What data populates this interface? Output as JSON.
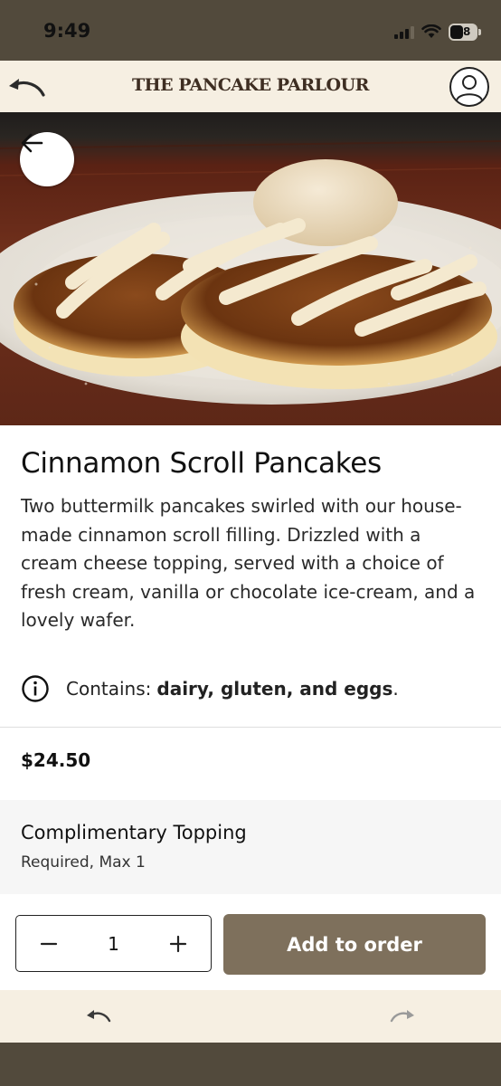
{
  "status_bar": {
    "time": "9:49",
    "battery": "48"
  },
  "header": {
    "brand": "THE PANCAKE PARLOUR",
    "back_icon": "curved-back-arrow-icon",
    "account_icon": "user-circle-icon"
  },
  "hero": {
    "back_icon": "arrow-left-icon"
  },
  "item": {
    "title": "Cinnamon Scroll Pancakes",
    "description": "Two buttermilk pancakes swirled with our house-made cinnamon scroll filling. Drizzled with a cream cheese topping, served with a choice of fresh cream, vanilla or chocolate ice-cream, and a lovely wafer.",
    "allergen_prefix": "Contains:",
    "allergen_list": "dairy, gluten, and eggs",
    "allergen_suffix": ".",
    "price": "$24.50"
  },
  "option_group": {
    "title": "Complimentary Topping",
    "subtitle": "Required, Max 1"
  },
  "order": {
    "quantity": "1",
    "add_label": "Add to order"
  },
  "colors": {
    "header_bg": "#f6efe2",
    "status_bg": "#524a3c",
    "add_button": "#7e705c",
    "brand_text": "#3e2e22"
  }
}
